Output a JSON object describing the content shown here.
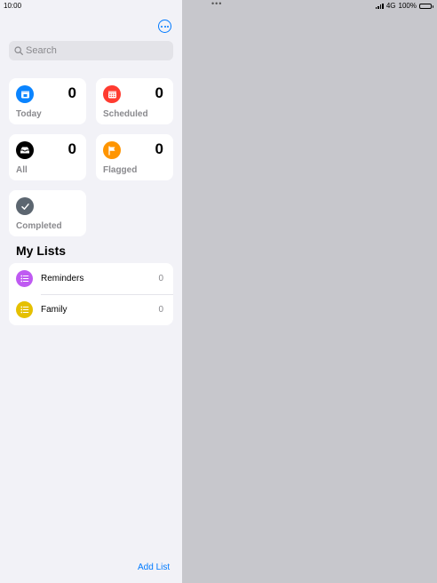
{
  "status": {
    "time": "10:00",
    "network": "4G",
    "battery": "100%"
  },
  "header": {
    "more_icon": "ellipsis-circle-icon"
  },
  "search": {
    "placeholder": "Search",
    "value": ""
  },
  "smart_lists": [
    {
      "label": "Today",
      "count": "0",
      "color": "#0a84ff",
      "icon": "calendar-today-icon"
    },
    {
      "label": "Scheduled",
      "count": "0",
      "color": "#ff3b30",
      "icon": "calendar-icon"
    },
    {
      "label": "All",
      "count": "0",
      "color": "#000000",
      "icon": "tray-icon"
    },
    {
      "label": "Flagged",
      "count": "0",
      "color": "#ff9500",
      "icon": "flag-icon"
    },
    {
      "label": "Completed",
      "color": "#5c6670",
      "icon": "checkmark-icon"
    }
  ],
  "my_lists": {
    "title": "My Lists",
    "items": [
      {
        "name": "Reminders",
        "count": "0",
        "color": "#bf5af2",
        "icon": "list-bullet-icon"
      },
      {
        "name": "Family",
        "count": "0",
        "color": "#e5c000",
        "icon": "list-bullet-icon"
      }
    ]
  },
  "footer": {
    "add_list_label": "Add List"
  }
}
